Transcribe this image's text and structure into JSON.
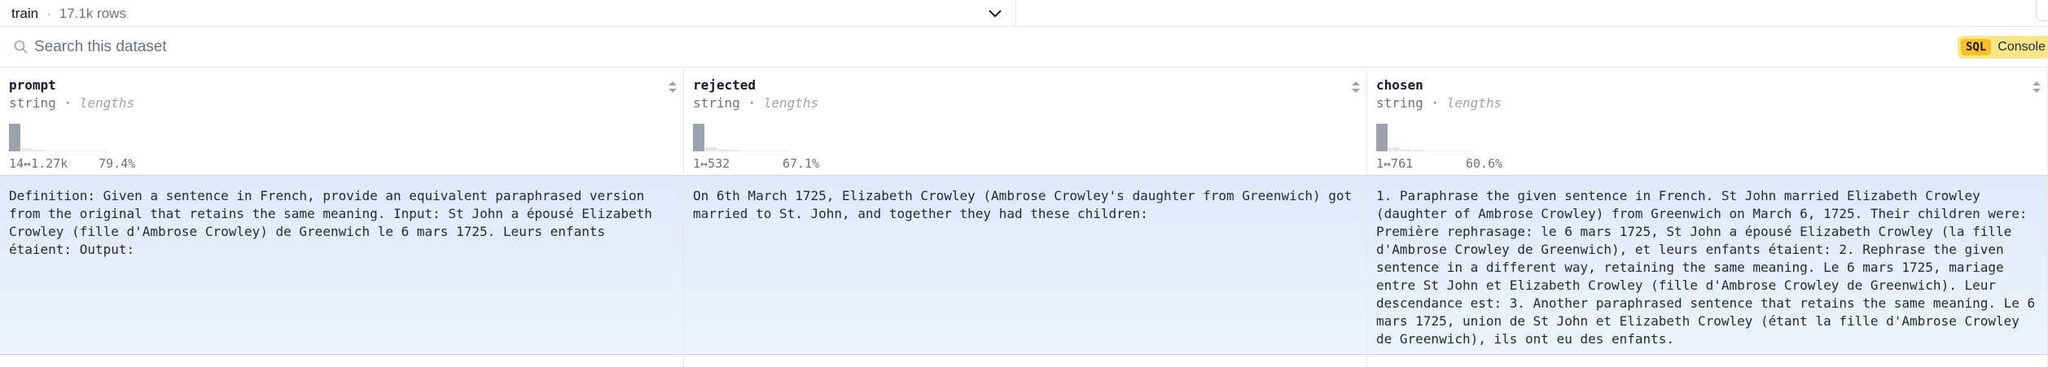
{
  "split": {
    "name": "train",
    "separator": "·",
    "rows": "17.1k rows"
  },
  "search": {
    "placeholder": "Search this dataset"
  },
  "sql_console": {
    "badge": "SQL",
    "label": "Console"
  },
  "columns": [
    {
      "name": "prompt",
      "type": "string",
      "type_sub": "lengths",
      "range": "14↔1.27k",
      "percent": "79.4%",
      "hist_values": [
        1.0,
        0.12,
        0.05,
        0.03,
        0.02,
        0.02,
        0.01,
        0.01
      ]
    },
    {
      "name": "rejected",
      "type": "string",
      "type_sub": "lengths",
      "range": "1↔532",
      "percent": "67.1%",
      "hist_values": [
        1.0,
        0.15,
        0.08,
        0.05,
        0.03,
        0.02,
        0.01,
        0.01
      ]
    },
    {
      "name": "chosen",
      "type": "string",
      "type_sub": "lengths",
      "range": "1↔761",
      "percent": "60.6%",
      "hist_values": [
        1.0,
        0.14,
        0.07,
        0.05,
        0.03,
        0.02,
        0.01,
        0.01
      ]
    }
  ],
  "rows": [
    {
      "prompt": "Definition: Given a sentence in French, provide an equivalent paraphrased version from the original that retains the same meaning. Input: St John a épousé Elizabeth Crowley (fille d'Ambrose Crowley) de Greenwich le 6 mars 1725. Leurs enfants étaient: Output:",
      "rejected": "On 6th March 1725, Elizabeth Crowley (Ambrose Crowley's daughter from Greenwich) got married to St. John, and together they had these children:",
      "chosen": "1. Paraphrase the given sentence in French. St John married Elizabeth Crowley (daughter of Ambrose Crowley) from Greenwich on March 6, 1725. Their children were: Première rephrasage: le 6 mars 1725, St John a épousé Elizabeth Crowley (la fille d'Ambrose Crowley de Greenwich), et leurs enfants étaient: 2. Rephrase the given sentence in a different way, retaining the same meaning. Le 6 mars 1725, mariage entre St John et Elizabeth Crowley (fille d'Ambrose Crowley de Greenwich). Leur descendance est: 3. Another paraphrased sentence that retains the same meaning. Le 6 mars 1725, union de St John et Elizabeth Crowley (étant la fille d'Ambrose Crowley de Greenwich), ils ont eu des enfants."
    }
  ],
  "colors": {
    "row_highlight": "#dfe9fb",
    "hist_bar": "#9ca3af",
    "sql_badge": "#fbbf24"
  }
}
